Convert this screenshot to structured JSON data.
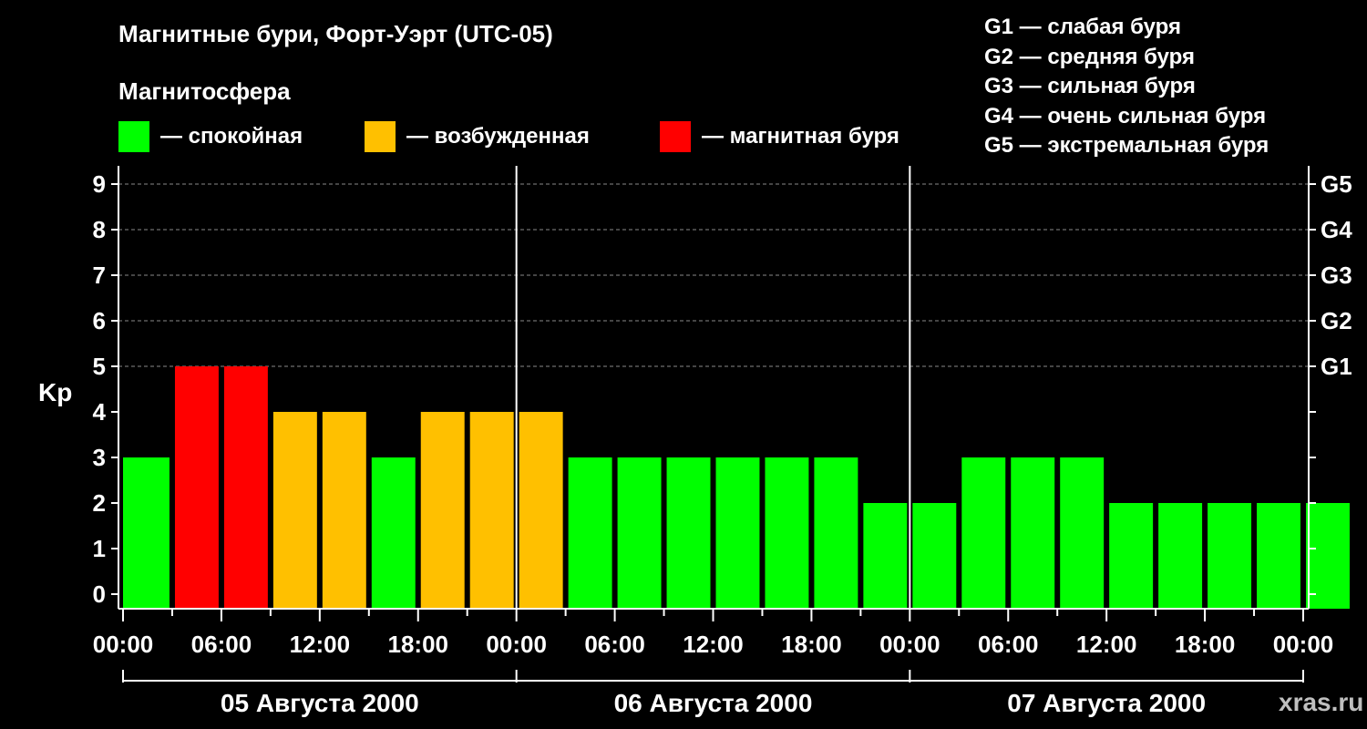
{
  "header": {
    "title": "Магнитные бури, Форт-Уэрт (UTC-05)",
    "subtitle": "Магнитосфера"
  },
  "legend": [
    {
      "label": "— спокойная",
      "color": "#00ff00"
    },
    {
      "label": "— возбужденная",
      "color": "#ffc000"
    },
    {
      "label": "— магнитная буря",
      "color": "#ff0000"
    }
  ],
  "g_scale": [
    "G1 — слабая буря",
    "G2 — средняя буря",
    "G3 — сильная буря",
    "G4 — очень сильная буря",
    "G5 — экстремальная буря"
  ],
  "watermark": "xras.ru",
  "chart_data": {
    "type": "bar",
    "ylabel": "Kp",
    "ylim": [
      0,
      9
    ],
    "yticks": [
      "0",
      "1",
      "2",
      "3",
      "4",
      "5",
      "6",
      "7",
      "8",
      "9"
    ],
    "right_axis_labels": [
      {
        "kp": 5,
        "label": "G1"
      },
      {
        "kp": 6,
        "label": "G2"
      },
      {
        "kp": 7,
        "label": "G3"
      },
      {
        "kp": 8,
        "label": "G4"
      },
      {
        "kp": 9,
        "label": "G5"
      }
    ],
    "grid": "dashed horizontal at Kp 5–9",
    "xticks": [
      "00:00",
      "06:00",
      "12:00",
      "18:00",
      "00:00",
      "06:00",
      "12:00",
      "18:00",
      "00:00",
      "06:00",
      "12:00",
      "18:00",
      "00:00"
    ],
    "days": [
      "05 Августа 2000",
      "06 Августа 2000",
      "07 Августа 2000"
    ],
    "bar_interval_hours": 3,
    "values": [
      3,
      5,
      5,
      4,
      4,
      3,
      4,
      4,
      4,
      3,
      3,
      3,
      3,
      3,
      3,
      2,
      2,
      3,
      3,
      3,
      2,
      2,
      2,
      2,
      2
    ],
    "colors": {
      "calm": "#00ff00",
      "active": "#ffc000",
      "storm": "#ff0000"
    }
  }
}
